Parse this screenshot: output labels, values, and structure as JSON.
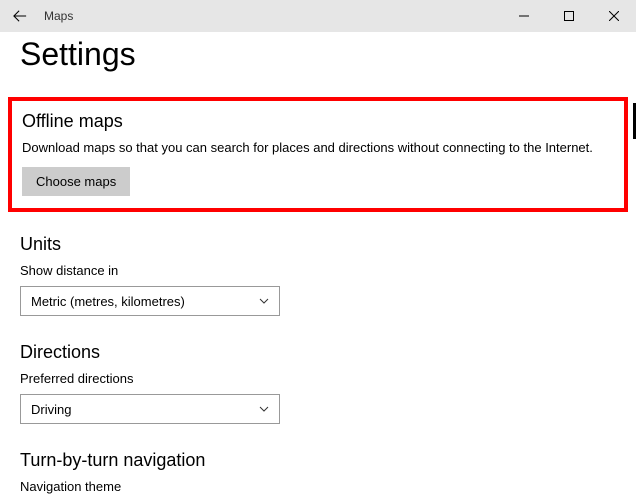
{
  "titlebar": {
    "app_name": "Maps"
  },
  "page": {
    "header": "Settings"
  },
  "offline": {
    "title": "Offline maps",
    "description": "Download maps so that you can search for places and directions without connecting to the Internet.",
    "button": "Choose maps"
  },
  "units": {
    "title": "Units",
    "label": "Show distance in",
    "selected": "Metric (metres, kilometres)"
  },
  "directions": {
    "title": "Directions",
    "label": "Preferred directions",
    "selected": "Driving"
  },
  "navigation": {
    "title": "Turn-by-turn navigation",
    "label": "Navigation theme"
  }
}
